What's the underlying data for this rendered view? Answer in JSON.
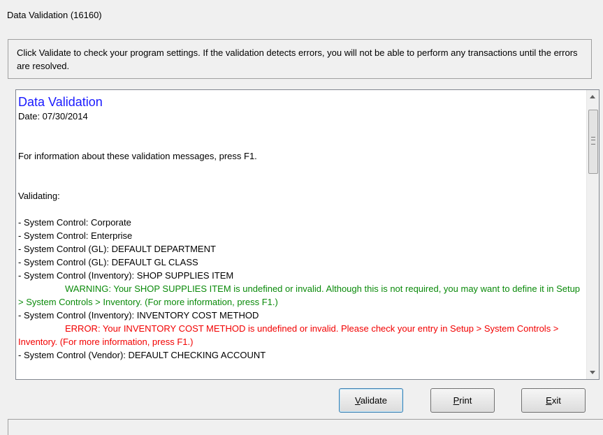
{
  "window": {
    "title": "Data Validation (16160)"
  },
  "instructions": "Click Validate to check your program settings. If the validation detects errors, you will not be able to perform any transactions until the errors are resolved.",
  "log": {
    "title": "Data Validation",
    "date": "Date: 07/30/2014",
    "info": "For information about these validation messages, press F1.",
    "validating": "Validating:",
    "lines": [
      {
        "type": "normal",
        "text": "- System Control: Corporate"
      },
      {
        "type": "normal",
        "text": "- System Control: Enterprise"
      },
      {
        "type": "normal",
        "text": "- System Control (GL): DEFAULT DEPARTMENT"
      },
      {
        "type": "normal",
        "text": "- System Control (GL): DEFAULT GL CLASS"
      },
      {
        "type": "normal",
        "text": "- System Control (Inventory): SHOP SUPPLIES ITEM"
      },
      {
        "type": "warning",
        "text": "WARNING: Your SHOP SUPPLIES ITEM is undefined or invalid. Although this is not required, you may want to define it in Setup > System Controls > Inventory. (For more information, press F1.)"
      },
      {
        "type": "normal",
        "text": "- System Control (Inventory): INVENTORY COST METHOD"
      },
      {
        "type": "error",
        "text": "ERROR: Your INVENTORY COST METHOD is undefined or invalid. Please check your entry in Setup > System Controls > Inventory. (For more information, press F1.)"
      },
      {
        "type": "normal",
        "text": "- System Control (Vendor): DEFAULT CHECKING ACCOUNT"
      }
    ]
  },
  "buttons": {
    "validate": {
      "accel": "V",
      "rest": "alidate"
    },
    "print": {
      "accel": "P",
      "rest": "rint"
    },
    "exit": {
      "accel": "E",
      "rest": "xit"
    }
  },
  "icons": {
    "scroll_up": "scroll-up-arrow",
    "scroll_down": "scroll-down-arrow"
  },
  "colors": {
    "title": "#1a1aff",
    "warning": "#0a8a0a",
    "error": "#f20000"
  }
}
